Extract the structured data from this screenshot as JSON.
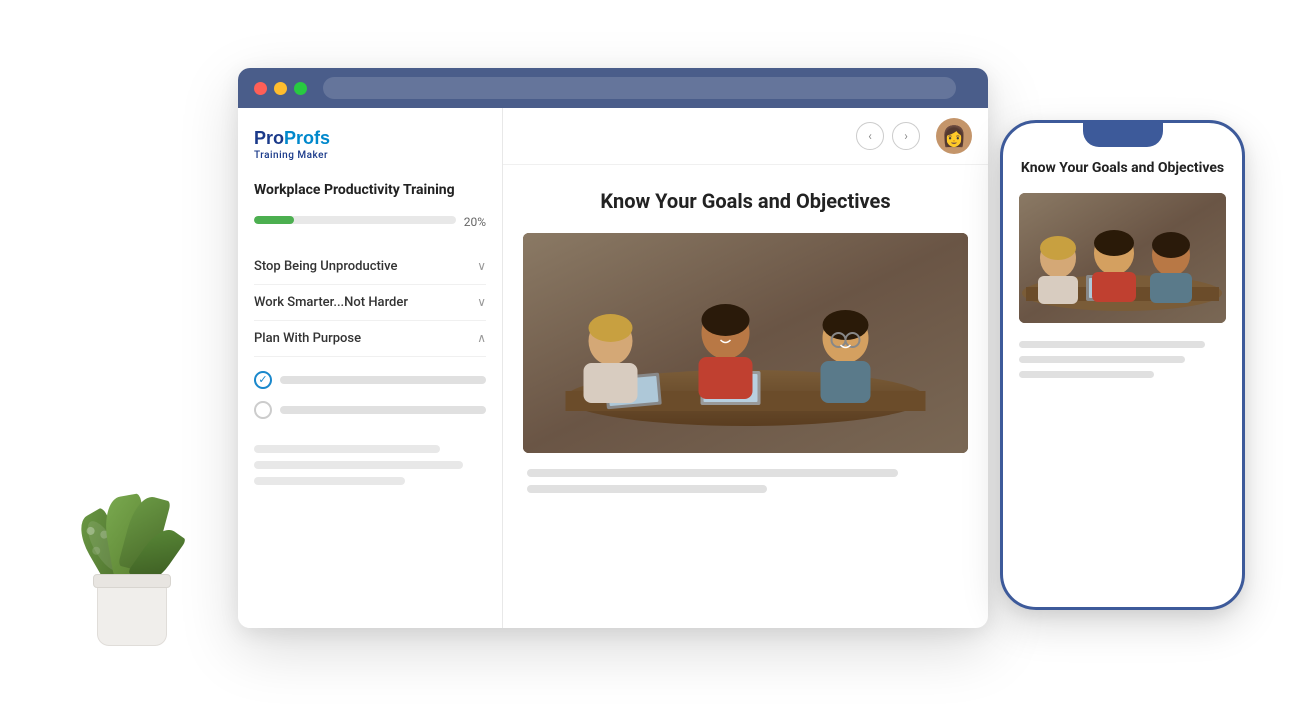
{
  "browser": {
    "titlebar": {
      "dot_red": "red",
      "dot_yellow": "yellow",
      "dot_green": "green"
    }
  },
  "sidebar": {
    "logo": {
      "pro": "Pro",
      "profs": "Profs",
      "sub": "Training Maker"
    },
    "course_title": "Workplace Productivity Training",
    "progress": {
      "value": 20,
      "label": "20%"
    },
    "menu_items": [
      {
        "label": "Stop Being Unproductive",
        "chevron": "∨",
        "expanded": false
      },
      {
        "label": "Work Smarter...Not Harder",
        "chevron": "∨",
        "expanded": false
      },
      {
        "label": "Plan With Purpose",
        "chevron": "∧",
        "expanded": true
      }
    ],
    "submenu": [
      {
        "checked": true
      },
      {
        "checked": false
      }
    ]
  },
  "main": {
    "lesson_title": "Know Your Goals and Objectives",
    "nav_prev": "‹",
    "nav_next": "›"
  },
  "phone": {
    "lesson_title": "Know Your Goals and Objectives"
  }
}
